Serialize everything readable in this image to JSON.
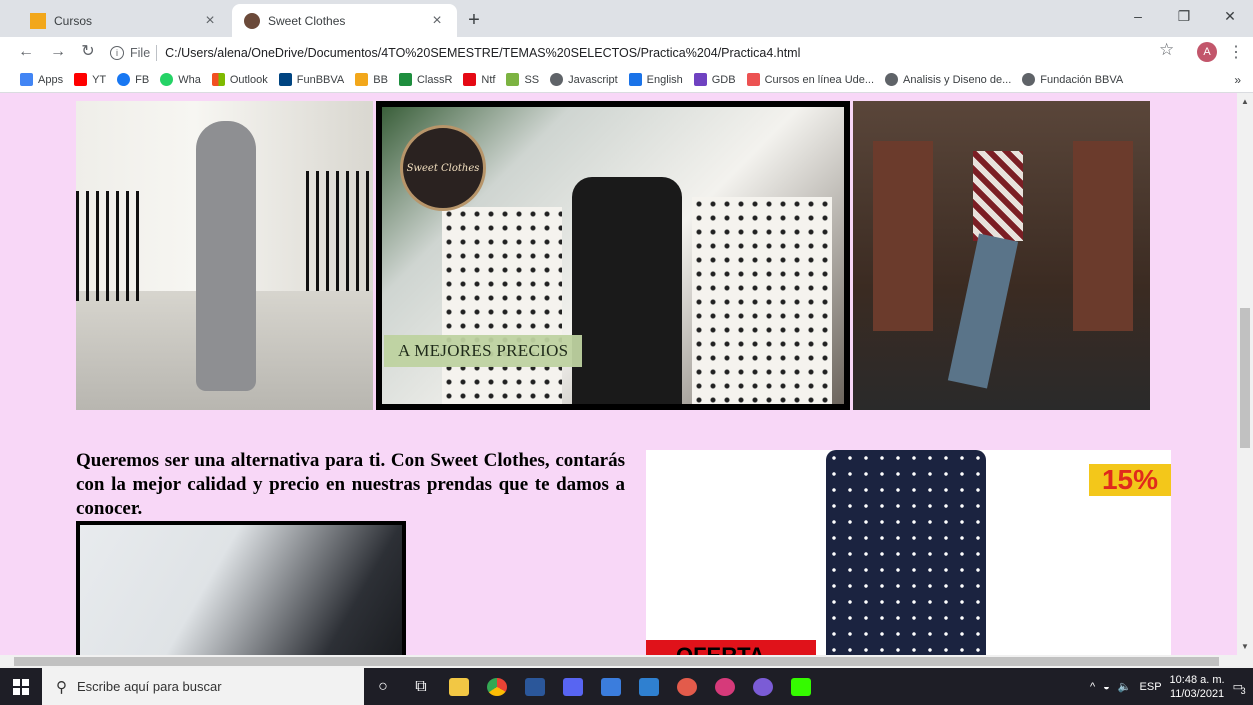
{
  "browser": {
    "tabs": [
      {
        "title": "Cursos",
        "favicon_color": "#f2a71b",
        "active": false
      },
      {
        "title": "Sweet Clothes",
        "favicon_color": "#6b4a3a",
        "active": true
      }
    ],
    "new_tab_icon": "plus-icon",
    "address": {
      "scheme_label": "File",
      "url": "C:/Users/alena/OneDrive/Documentos/4TO%20SEMESTRE/TEMAS%20SELECTOS/Practica%204/Practica4.html"
    },
    "profile_initial": "A",
    "bookmarks": [
      {
        "label": "Apps",
        "color": "#4285f4"
      },
      {
        "label": "YT",
        "color": "#ff0000"
      },
      {
        "label": "FB",
        "color": "#1877f2"
      },
      {
        "label": "Wha",
        "color": "#25d366"
      },
      {
        "label": "Outlook",
        "color": "#f25022"
      },
      {
        "label": "FunBBVA",
        "color": "#004481"
      },
      {
        "label": "BB",
        "color": "#f2a71b"
      },
      {
        "label": "ClassR",
        "color": "#1e8e3e"
      },
      {
        "label": "Ntf",
        "color": "#e50914"
      },
      {
        "label": "SS",
        "color": "#7cb342"
      },
      {
        "label": "Javascript",
        "color": "#5f6368"
      },
      {
        "label": "English",
        "color": "#1a73e8"
      },
      {
        "label": "GDB",
        "color": "#6f42c1"
      },
      {
        "label": "Cursos en línea Ude...",
        "color": "#ec5252"
      },
      {
        "label": "Analisis y Diseno de...",
        "color": "#5f6368"
      },
      {
        "label": "Fundación BBVA",
        "color": "#5f6368"
      }
    ],
    "bookmarks_more": "»"
  },
  "page": {
    "logo_text": "Sweet Clothes",
    "price_banner": "A MEJORES PRECIOS",
    "intro": "Queremos ser una alternativa para ti. Con Sweet Clothes, contarás con la mejor calidad y precio en nuestras prendas que te damos a conocer.",
    "discount": "15%",
    "offer_tag": "OFERTA"
  },
  "taskbar": {
    "search_placeholder": "Escribe aquí para buscar",
    "language": "ESP",
    "time": "10:48 a. m.",
    "date": "11/03/2021",
    "notification_count": "3"
  }
}
